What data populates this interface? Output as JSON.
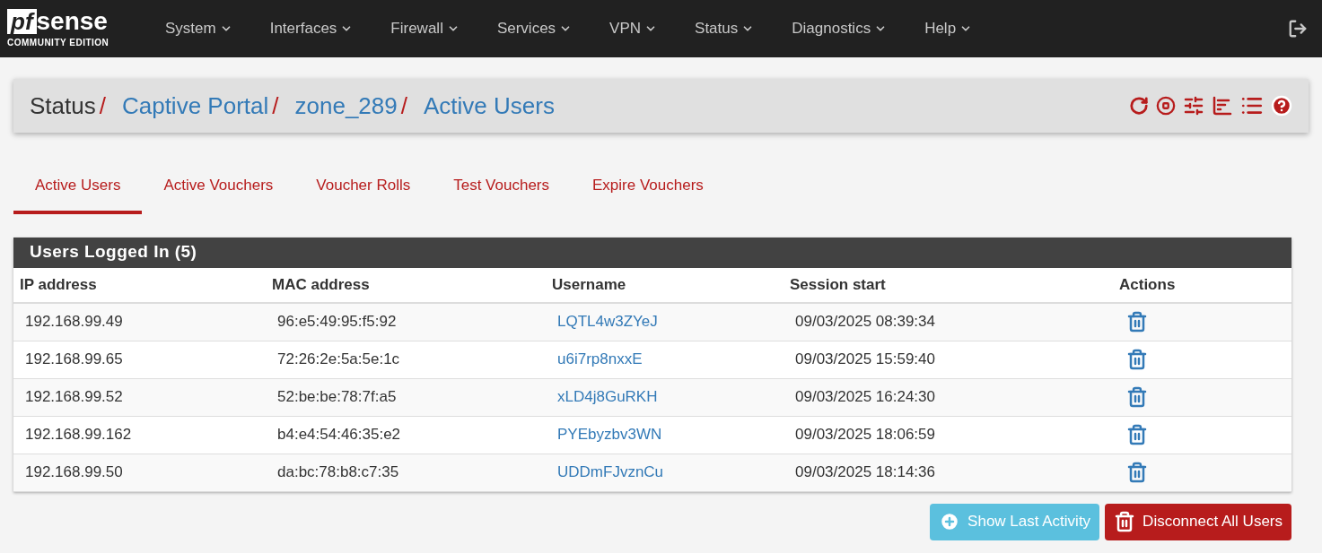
{
  "logo": {
    "mark": "pf",
    "word": "sense",
    "edition": "COMMUNITY EDITION"
  },
  "nav": [
    {
      "label": "System"
    },
    {
      "label": "Interfaces"
    },
    {
      "label": "Firewall"
    },
    {
      "label": "Services"
    },
    {
      "label": "VPN"
    },
    {
      "label": "Status"
    },
    {
      "label": "Diagnostics"
    },
    {
      "label": "Help"
    }
  ],
  "breadcrumb": {
    "separator": "/",
    "items": [
      {
        "label": "Status",
        "kind": "text"
      },
      {
        "label": "Captive Portal",
        "kind": "link"
      },
      {
        "label": "zone_289",
        "kind": "link"
      },
      {
        "label": "Active Users",
        "kind": "link"
      }
    ]
  },
  "tabs": [
    {
      "label": "Active Users",
      "selected": true
    },
    {
      "label": "Active Vouchers",
      "selected": false
    },
    {
      "label": "Voucher Rolls",
      "selected": false
    },
    {
      "label": "Test Vouchers",
      "selected": false
    },
    {
      "label": "Expire Vouchers",
      "selected": false
    }
  ],
  "panel": {
    "title": "Users Logged In (5)",
    "columns": [
      "IP address",
      "MAC address",
      "Username",
      "Session start",
      "Actions"
    ],
    "rows": [
      {
        "ip": "192.168.99.49",
        "mac": "96:e5:49:95:f5:92",
        "username": "LQTL4w3ZYeJ",
        "session_start": "09/03/2025 08:39:34"
      },
      {
        "ip": "192.168.99.65",
        "mac": "72:26:2e:5a:5e:1c",
        "username": "u6i7rp8nxxE",
        "session_start": "09/03/2025 15:59:40"
      },
      {
        "ip": "192.168.99.52",
        "mac": "52:be:be:78:7f:a5",
        "username": "xLD4j8GuRKH",
        "session_start": "09/03/2025 16:24:30"
      },
      {
        "ip": "192.168.99.162",
        "mac": "b4:e4:54:46:35:e2",
        "username": "PYEbyzbv3WN",
        "session_start": "09/03/2025 18:06:59"
      },
      {
        "ip": "192.168.99.50",
        "mac": "da:bc:78:b8:c7:35",
        "username": "UDDmFJvznCu",
        "session_start": "09/03/2025 18:14:36"
      }
    ]
  },
  "buttons": [
    {
      "label": "Show Last Activity",
      "kind": "info"
    },
    {
      "label": "Disconnect All Users",
      "kind": "danger"
    }
  ]
}
